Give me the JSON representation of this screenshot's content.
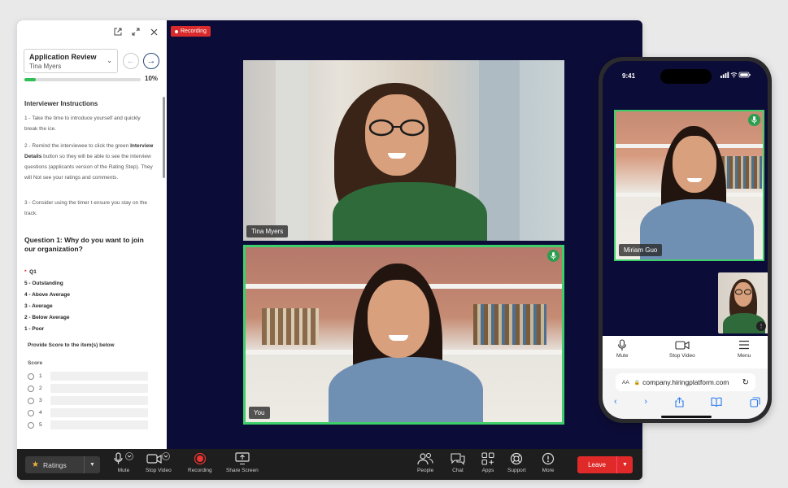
{
  "window": {
    "recording_badge": "Recording"
  },
  "panel": {
    "select_title": "Application Review",
    "select_subtitle": "Tina Myers",
    "progress_percent": 10,
    "progress_label": "10%",
    "instructions_title": "Interviewer Instructions",
    "instructions": [
      "1 - Take the time to introduce yourself and quickly break the ice.",
      "2 - Remind the interviewee to click the green",
      "Interview Details",
      "button so they will be able to see the interview questions (applicants version of the Rating Step). They will Not see your ratings and comments.",
      "3 - Consider using the timer t ensure you stay on the track."
    ],
    "question_title": "Question 1: Why do you want to join our organization?",
    "options": {
      "required_mark": "*",
      "q_label": "Q1",
      "items": [
        "5 - Outstanding",
        "4 - Above Average",
        "3 - Average",
        "2 - Below Average",
        "1 - Poor"
      ]
    },
    "provide_label": "Provide Score to the item(s) below",
    "score_label": "Score",
    "scores": [
      "1",
      "2",
      "3",
      "4",
      "5"
    ]
  },
  "videos": {
    "tile1_name": "Tina Myers",
    "tile2_name": "You"
  },
  "toolbar": {
    "ratings_label": "Ratings",
    "tools": [
      "Mute",
      "Stop Video",
      "Recording",
      "Share Screen",
      "People",
      "Chat",
      "Apps",
      "Support",
      "More"
    ],
    "leave_label": "Leave"
  },
  "phone": {
    "time": "9:41",
    "tile_name": "Miriam Guo",
    "tools": [
      "Mute",
      "Stop Video",
      "Menu"
    ],
    "url_aa": "AA",
    "url": "company.hiringplatform.com"
  },
  "colors": {
    "accent_green": "#3fcf6a",
    "leave_red": "#e02a2a",
    "stage_bg": "#0c0c38",
    "safari_blue": "#2d7bf0"
  }
}
